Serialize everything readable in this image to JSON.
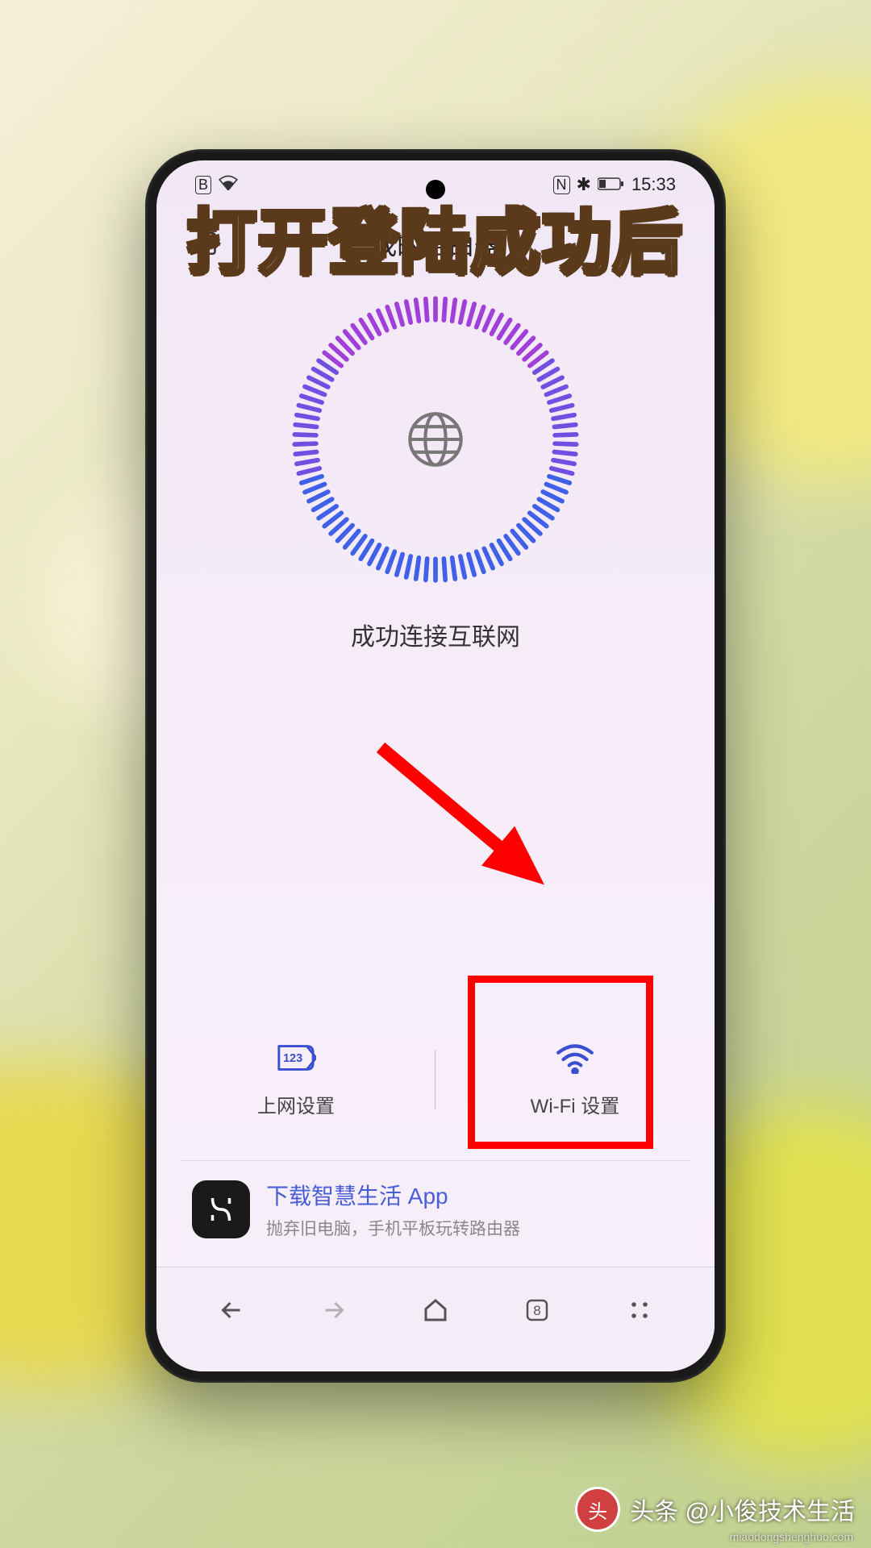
{
  "caption": "打开登陆成功后",
  "status_bar": {
    "left_badge": "B",
    "nfc": "N",
    "bt": "✱",
    "time": "15:33"
  },
  "header": {
    "title": "我的路由器"
  },
  "gauge": {
    "status_text": "成功连接互联网"
  },
  "tiles": {
    "internet_label": "上网设置",
    "wifi_label": "Wi-Fi 设置",
    "internet_icon_badge": "123"
  },
  "promo": {
    "title": "下载智慧生活 App",
    "subtitle": "抛弃旧电脑，手机平板玩转路由器"
  },
  "browser_nav": {
    "tabs_count": "8"
  },
  "watermark": {
    "prefix": "头条",
    "handle": "@小俊技术生活"
  },
  "watermark_site": "miaodongshenghuo.com"
}
